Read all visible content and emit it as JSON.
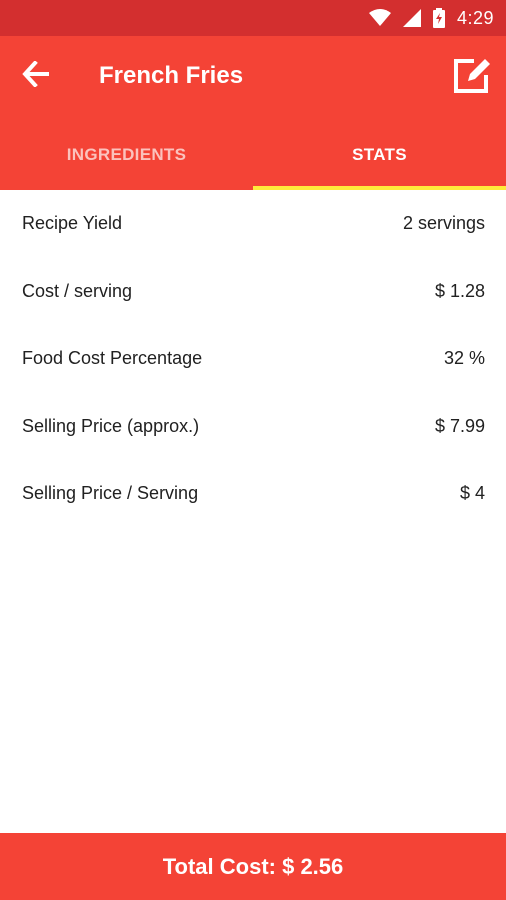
{
  "status_bar": {
    "time": "4:29",
    "icons": [
      "wifi-icon",
      "signal-icon",
      "battery-icon"
    ]
  },
  "app_bar": {
    "title": "French Fries",
    "back_icon": "arrow-back-icon",
    "edit_icon": "edit-icon",
    "color": "#f44336"
  },
  "tabs": [
    {
      "label": "INGREDIENTS",
      "active": false
    },
    {
      "label": "STATS",
      "active": true
    }
  ],
  "stats": [
    {
      "label": "Recipe Yield",
      "value": "2 servings"
    },
    {
      "label": "Cost / serving",
      "value": "$ 1.28"
    },
    {
      "label": "Food Cost Percentage",
      "value": "32 %"
    },
    {
      "label": "Selling Price (approx.)",
      "value": "$ 7.99"
    },
    {
      "label": "Selling Price / Serving",
      "value": "$ 4"
    }
  ],
  "footer": {
    "total_label": "Total Cost: $ 2.56"
  },
  "colors": {
    "primary": "#f44336",
    "primary_dark": "#d32f2f",
    "tab_indicator": "#ffeb3b"
  }
}
